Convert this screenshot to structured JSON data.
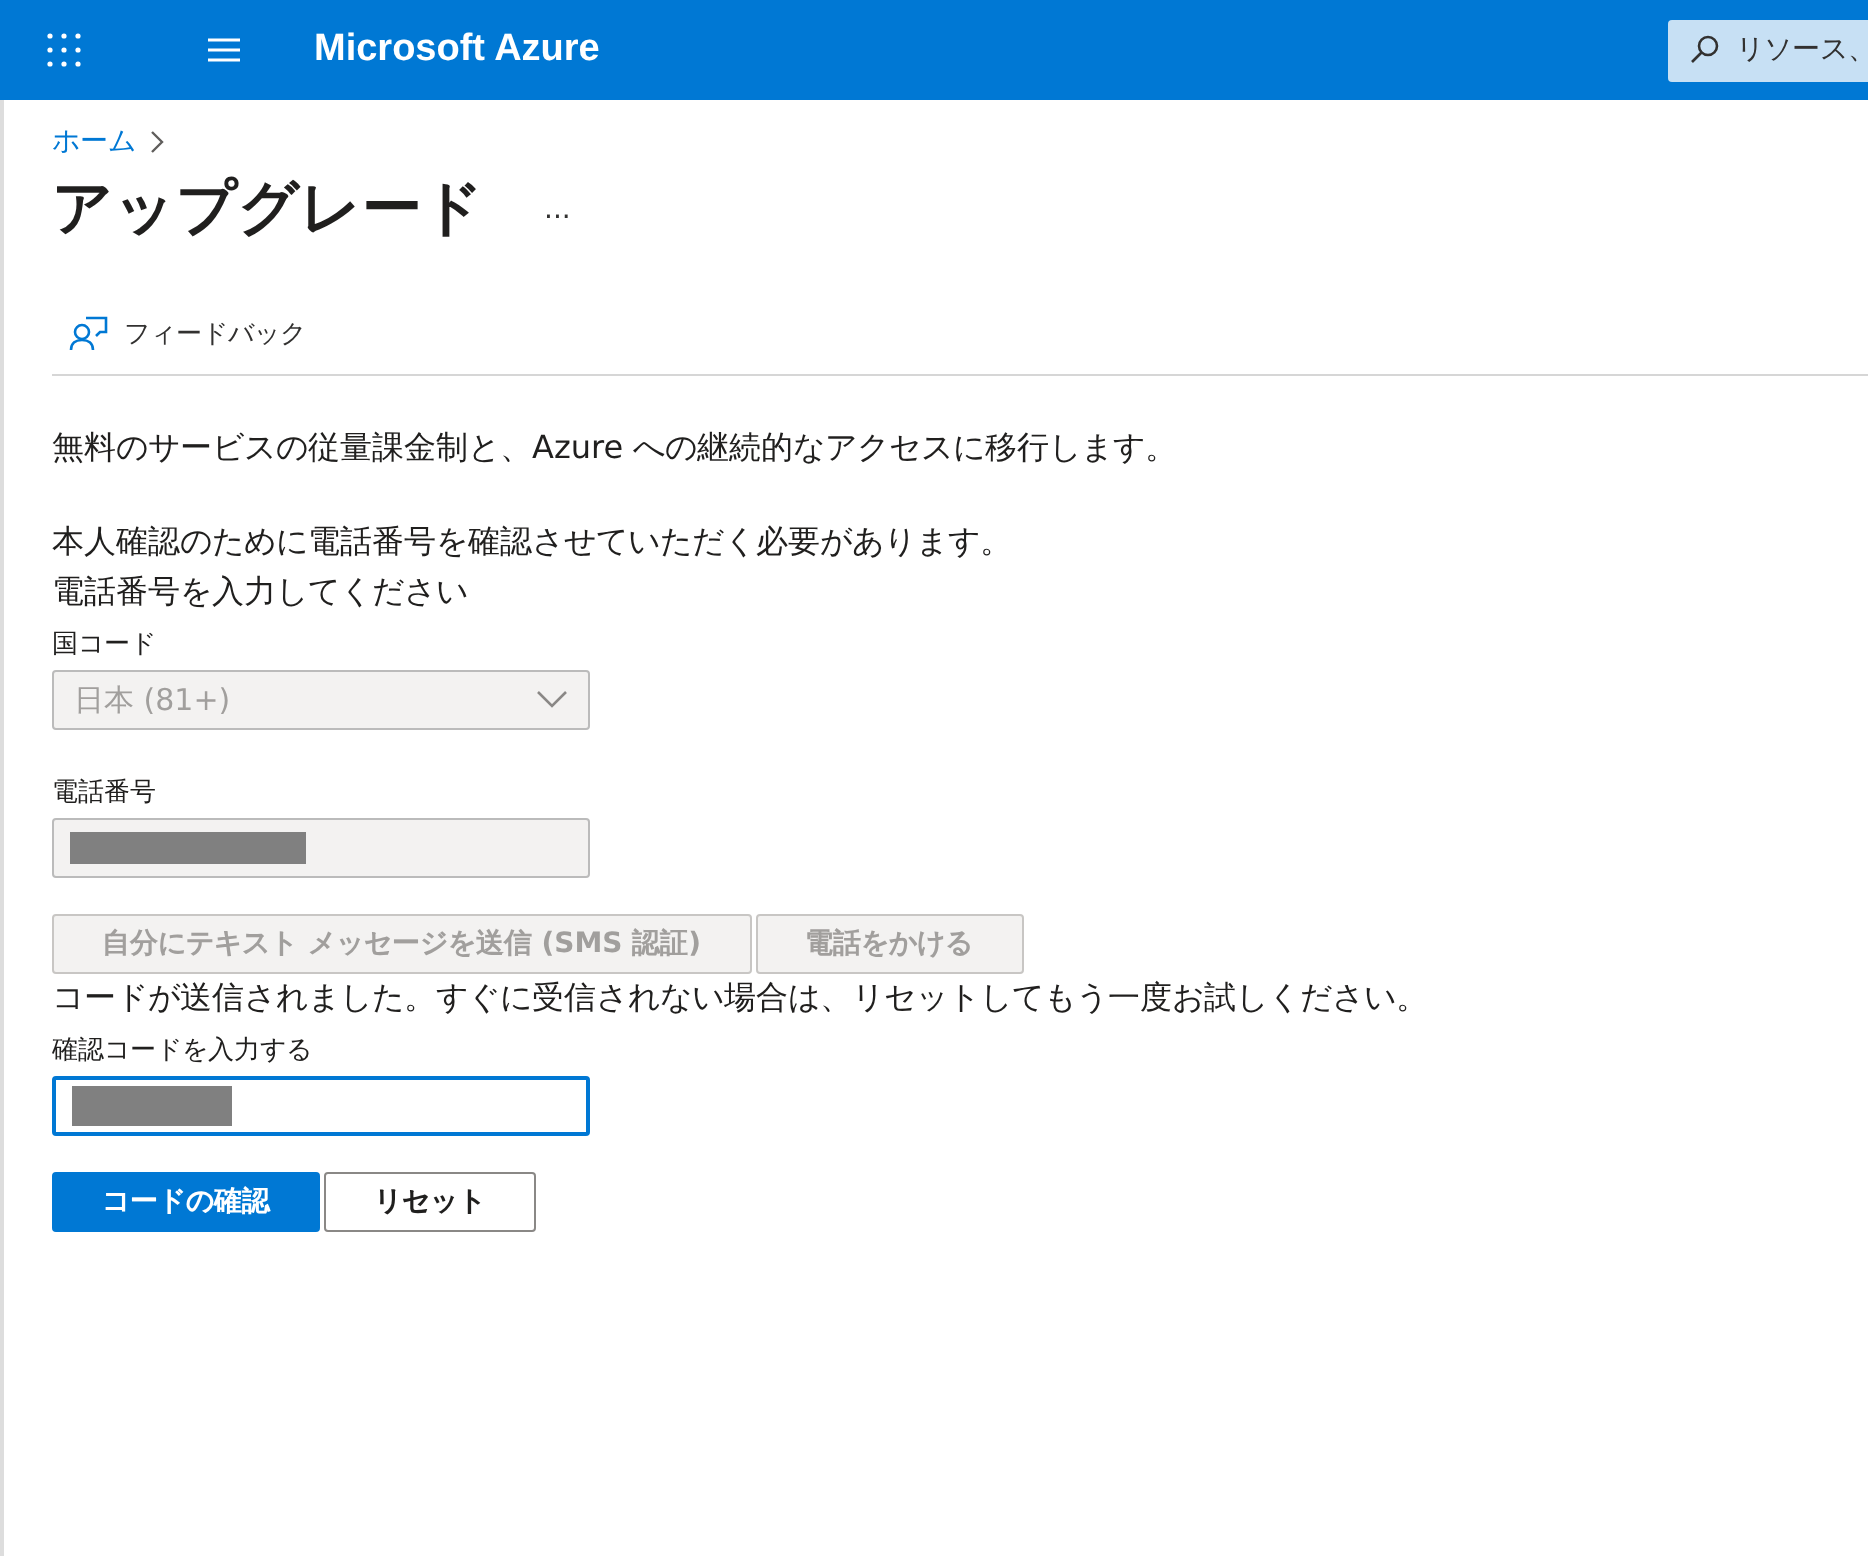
{
  "top_bar": {
    "title": "Microsoft Azure",
    "search": {
      "placeholder": "リソース、"
    }
  },
  "breadcrumb": [
    {
      "label": "ホーム"
    }
  ],
  "page": {
    "title": "アップグレード",
    "more": "..."
  },
  "toolbar": [
    {
      "label": "フィードバック"
    }
  ],
  "intro": "無料のサービスの従量課金制と、Azure への継続的なアクセスに移行します。",
  "verify_text": "本人確認のために電話番号を確認させていただく必要があります。",
  "prompt": "電話番号を入力してください",
  "country": {
    "label": "国コード",
    "value": "日本 (81+)",
    "disabled": true
  },
  "phone": {
    "label": "電話番号",
    "redacted": true,
    "disabled": true
  },
  "send_buttons": [
    {
      "label": "自分にテキスト メッセージを送信 (SMS 認証)",
      "disabled": true
    },
    {
      "label": "電話をかける",
      "disabled": true
    }
  ],
  "sent_message": "コードが送信されました。すぐに受信されない場合は、リセットしてもう一度お試しください。",
  "code": {
    "label": "確認コードを入力する",
    "redacted": true,
    "focused": true
  },
  "actions": [
    {
      "label": "コードの確認",
      "kind": "primary"
    },
    {
      "label": "リセット",
      "kind": "default"
    }
  ]
}
